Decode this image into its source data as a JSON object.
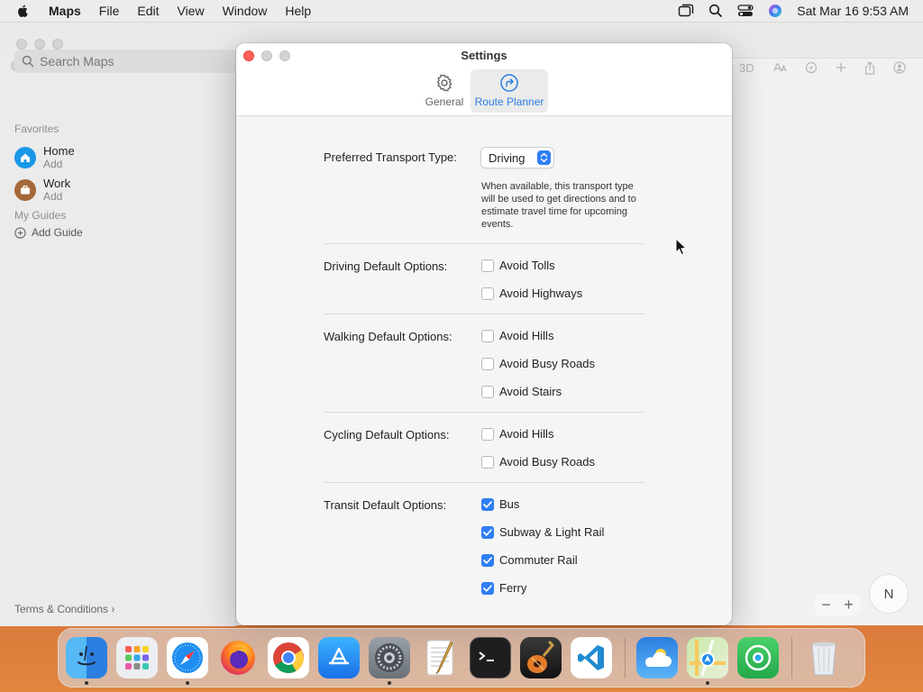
{
  "menubar": {
    "app_name": "Maps",
    "menus": [
      "File",
      "Edit",
      "View",
      "Window",
      "Help"
    ],
    "clock": "Sat Mar 16  9:53 AM"
  },
  "maps": {
    "search_placeholder": "Search Maps",
    "favorites_heading": "Favorites",
    "favorites": [
      {
        "title": "Home",
        "subtitle": "Add"
      },
      {
        "title": "Work",
        "subtitle": "Add"
      }
    ],
    "guides_heading": "My Guides",
    "add_guide_label": "Add Guide",
    "terms_label": "Terms & Conditions",
    "map_3d_label": "3D",
    "compass_label": "N",
    "zoom_out_label": "−",
    "zoom_in_label": "+"
  },
  "settings": {
    "title": "Settings",
    "tabs": [
      {
        "label": "General",
        "active": false
      },
      {
        "label": "Route Planner",
        "active": true
      }
    ],
    "transport": {
      "label": "Preferred Transport Type:",
      "value": "Driving",
      "help": "When available, this transport type will be used to get directions and to estimate travel time for upcoming events."
    },
    "groups": [
      {
        "label": "Driving Default Options:",
        "options": [
          {
            "label": "Avoid Tolls",
            "checked": false
          },
          {
            "label": "Avoid Highways",
            "checked": false
          }
        ]
      },
      {
        "label": "Walking Default Options:",
        "options": [
          {
            "label": "Avoid Hills",
            "checked": false
          },
          {
            "label": "Avoid Busy Roads",
            "checked": false
          },
          {
            "label": "Avoid Stairs",
            "checked": false
          }
        ]
      },
      {
        "label": "Cycling Default Options:",
        "options": [
          {
            "label": "Avoid Hills",
            "checked": false
          },
          {
            "label": "Avoid Busy Roads",
            "checked": false
          }
        ]
      },
      {
        "label": "Transit Default Options:",
        "options": [
          {
            "label": "Bus",
            "checked": true
          },
          {
            "label": "Subway & Light Rail",
            "checked": true
          },
          {
            "label": "Commuter Rail",
            "checked": true
          },
          {
            "label": "Ferry",
            "checked": true
          }
        ]
      }
    ]
  },
  "dock": {
    "apps": [
      "finder-icon",
      "launchpad-icon",
      "safari-icon",
      "firefox-icon",
      "chrome-icon",
      "app-store-icon",
      "system-settings-icon",
      "textedit-icon",
      "terminal-icon",
      "garageband-icon",
      "vscode-icon",
      "weather-icon",
      "maps-icon",
      "find-my-icon",
      "trash-icon"
    ]
  },
  "colors": {
    "accent": "#2f7ef3",
    "close": "#ff5f57"
  }
}
